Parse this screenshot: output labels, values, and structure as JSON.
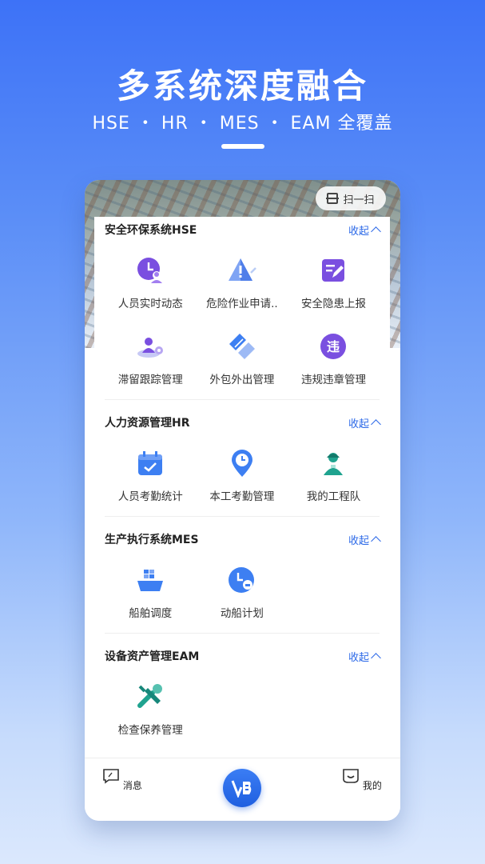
{
  "hero": {
    "title": "多系统深度融合",
    "subtitle": "HSE ・ HR ・ MES ・ EAM 全覆盖"
  },
  "topbar": {
    "scan_label": "扫一扫"
  },
  "sections": [
    {
      "title": "安全环保系统HSE",
      "collapse_label": "收起",
      "items": [
        {
          "label": "人员实时动态",
          "icon": "person-clock-icon"
        },
        {
          "label": "危险作业申请..",
          "icon": "warning-icon"
        },
        {
          "label": "安全隐患上报",
          "icon": "edit-report-icon"
        },
        {
          "label": "滞留跟踪管理",
          "icon": "person-track-icon"
        },
        {
          "label": "外包外出管理",
          "icon": "outsource-icon"
        },
        {
          "label": "违规违章管理",
          "icon": "violation-icon"
        }
      ]
    },
    {
      "title": "人力资源管理HR",
      "collapse_label": "收起",
      "items": [
        {
          "label": "人员考勤统计",
          "icon": "calendar-check-icon"
        },
        {
          "label": "本工考勤管理",
          "icon": "location-clock-icon"
        },
        {
          "label": "我的工程队",
          "icon": "team-icon"
        }
      ]
    },
    {
      "title": "生产执行系统MES",
      "collapse_label": "收起",
      "items": [
        {
          "label": "船舶调度",
          "icon": "ship-icon"
        },
        {
          "label": "动船计划",
          "icon": "ship-plan-icon"
        }
      ]
    },
    {
      "title": "设备资产管理EAM",
      "collapse_label": "收起",
      "items": [
        {
          "label": "检查保养管理",
          "icon": "tools-icon"
        }
      ]
    }
  ],
  "tabbar": {
    "messages_label": "消息",
    "mine_label": "我的"
  },
  "colors": {
    "accent": "#2d6ae8",
    "hse_purple": "#7a4fe0",
    "hr_blue": "#3d7ff2",
    "teal": "#1fa38f"
  }
}
